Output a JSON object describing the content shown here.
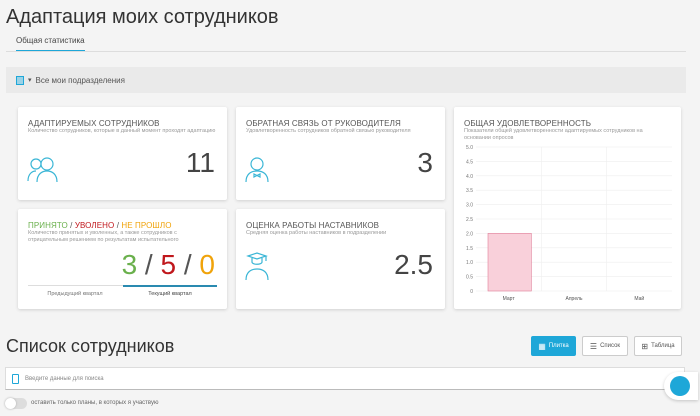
{
  "header": {
    "title": "Адаптация моих сотрудников",
    "tab": "Общая статистика"
  },
  "filter": {
    "label": "Все мои подразделения"
  },
  "cards": {
    "adapting": {
      "title": "Адаптируемых сотрудников",
      "desc": "Количество сотрудников, которые в данный момент проходят адаптацию",
      "value": "11"
    },
    "feedback": {
      "title": "Обратная связь от руководителя",
      "desc": "Удовлетворенность сотрудников обратной связью руководителя",
      "value": "3"
    },
    "hired": {
      "title_hired": "ПРИНЯТО",
      "title_fired": "УВОЛЕНО",
      "title_failed": "НЕ ПРОШЛО",
      "sep": " / ",
      "desc": "Количество принятых и уволенных, а также сотрудников с отрицательным решением по результатам испытательного",
      "hired": "3",
      "fired": "5",
      "failed": "0",
      "tab_prev": "Предыдущий квартал",
      "tab_current": "Текущий квартал"
    },
    "mentors": {
      "title": "Оценка работы наставников",
      "desc": "Средняя оценка работы наставников в подразделении",
      "value": "2.5"
    }
  },
  "chart_data": {
    "type": "bar",
    "title": "ОБЩАЯ УДОВЛЕТВОРЕННОСТЬ",
    "subtitle": "Показатели общей удовлетворенности адаптируемых сотрудников на основании опросов",
    "categories": [
      "Март",
      "Апрель",
      "Май"
    ],
    "values": [
      2,
      0,
      0
    ],
    "ylim": [
      0,
      5
    ],
    "yticks": [
      "0",
      "0.5",
      "1.0",
      "1.5",
      "2.0",
      "2.5",
      "3.0",
      "3.5",
      "4.0",
      "4.5",
      "5.0"
    ],
    "bar_color": "#f9d0da",
    "grid": true
  },
  "list": {
    "title": "Список сотрудников",
    "view_tiles": "Плитка",
    "view_list": "Список",
    "view_table": "Таблица",
    "search_placeholder": "Введите данные для поиска",
    "toggle_label": "оставить только планы, в которых я участвую"
  },
  "colors": {
    "accent": "#1ea7d8",
    "green": "#6ab04c",
    "red": "#c0171c",
    "orange": "#f0a30a"
  }
}
